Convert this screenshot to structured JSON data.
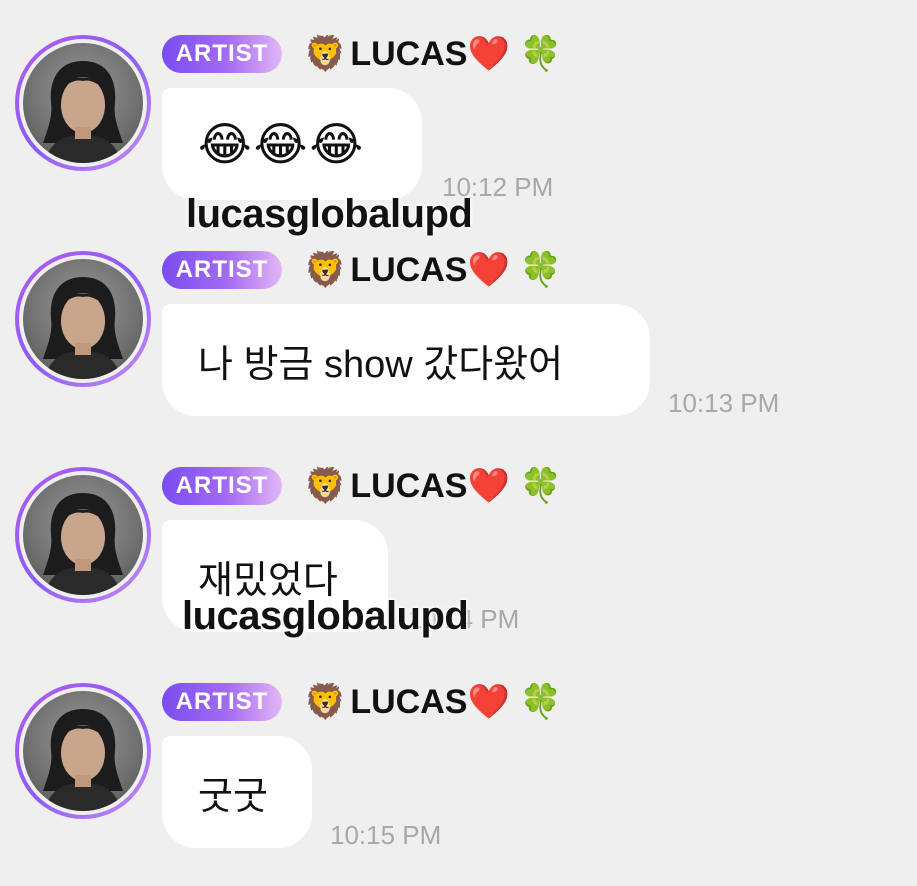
{
  "messages": [
    {
      "badge": "ARTIST",
      "sender_prefix_emoji": "🦁",
      "sender": "LUCAS",
      "sender_suffix_emoji": "❤️",
      "sender_extra_emoji": "🍀",
      "text": "😂😂😂",
      "time": "10:12 PM"
    },
    {
      "badge": "ARTIST",
      "sender_prefix_emoji": "🦁",
      "sender": "LUCAS",
      "sender_suffix_emoji": "❤️",
      "sender_extra_emoji": "🍀",
      "text": "나 방금 show 갔다왔어",
      "time": "10:13 PM"
    },
    {
      "badge": "ARTIST",
      "sender_prefix_emoji": "🦁",
      "sender": "LUCAS",
      "sender_suffix_emoji": "❤️",
      "sender_extra_emoji": "🍀",
      "text": "재밌었다",
      "time": "10:14 PM"
    },
    {
      "badge": "ARTIST",
      "sender_prefix_emoji": "🦁",
      "sender": "LUCAS",
      "sender_suffix_emoji": "❤️",
      "sender_extra_emoji": "🍀",
      "text": "굿굿",
      "time": "10:15 PM"
    }
  ],
  "watermarks": [
    "lucasglobalupd",
    "lucasglobalupd"
  ],
  "colors": {
    "background": "#efefef",
    "bubble": "#ffffff",
    "badge_gradient_start": "#7a4df0",
    "badge_gradient_end": "#e2b6f7",
    "timestamp": "#a8a8a8"
  },
  "icons": {
    "avatar": "profile-photo",
    "sender_prefix": "lion-emoji",
    "sender_suffix": "red-heart-emoji",
    "sender_extra": "four-leaf-clover-emoji"
  }
}
